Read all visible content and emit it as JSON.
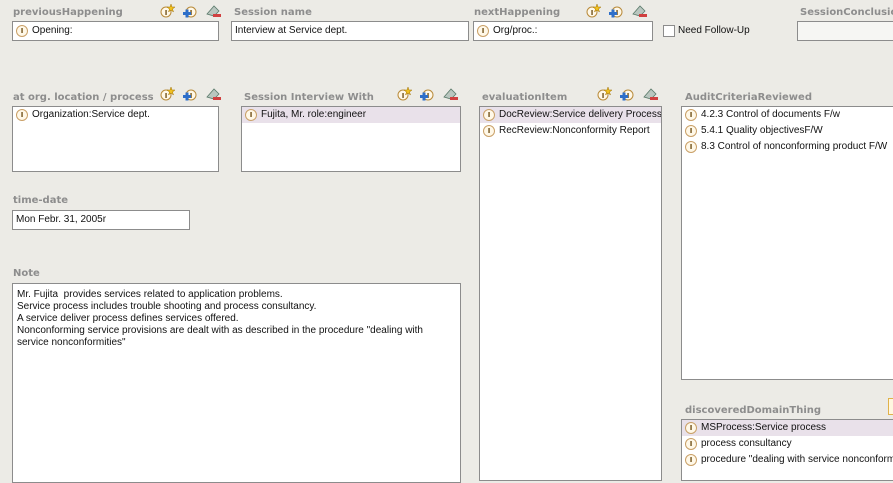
{
  "labels": {
    "previous_happening": "previousHappening",
    "session_name": "Session name",
    "next_happening": "nextHappening",
    "session_conclusion": "SessionConclusio",
    "at_org": "at org. location / process",
    "session_interview_with": "Session Interview With",
    "evaluation_item": "evaluationItem",
    "audit_criteria": "AuditCriteriaReviewed",
    "time_date": "time-date",
    "note": "Note",
    "discovered": "discoveredDomainThing",
    "need_follow_up": "Need Follow-Up"
  },
  "values": {
    "previous_happening": "Opening:",
    "session_name": "Interview at Service dept.",
    "next_happening": "Org/proc.:",
    "session_conclusion": "",
    "time_date": "Mon Febr. 31, 2005r",
    "note": "Mr. Fujita  provides services related to application problems.\nService process includes trouble shooting and process consultancy.\nA service deliver process defines services offered.\nNonconforming service provisions are dealt with as described in the procedure \"dealing with\nservice nonconformities\""
  },
  "lists": {
    "at_org": [
      "Organization:Service dept."
    ],
    "interview_with": [
      "Fujita, Mr. role:engineer"
    ],
    "evaluation_item": [
      "DocReview:Service delivery Process",
      "RecReview:Nonconformity Report"
    ],
    "audit_criteria": [
      "4.2.3 Control of documents F/w",
      "5.4.1 Quality objectivesF/W",
      "8.3 Control of nonconforming product F/W"
    ],
    "discovered": [
      "MSProcess:Service process",
      "process consultancy",
      "procedure \"dealing with service nonconformities\""
    ]
  },
  "icons": {
    "instance": "instance-icon",
    "create": "create-instance-icon",
    "add": "add-instance-icon",
    "remove": "remove-instance-icon"
  }
}
